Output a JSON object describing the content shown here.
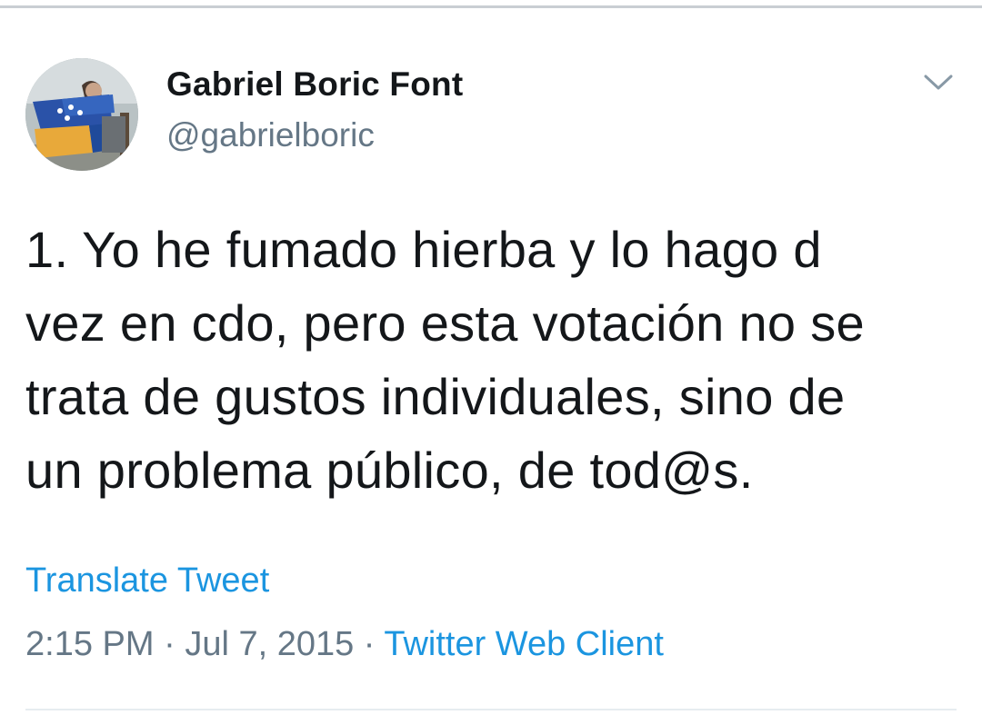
{
  "author": {
    "display_name": "Gabriel Boric Font",
    "handle": "@gabrielboric",
    "avatar_icon": "profile-photo"
  },
  "menu_icon": "chevron-down-icon",
  "tweet": {
    "lines": [
      "1. Yo he fumado hierba y lo hago d",
      "vez en cdo, pero esta votación no se",
      "trata de gustos individuales, sino de",
      "un problema público, de tod@s."
    ]
  },
  "translate_label": "Translate Tweet",
  "meta": {
    "time": "2:15 PM",
    "separator": "·",
    "date": "Jul 7, 2015",
    "source": "Twitter Web Client"
  },
  "colors": {
    "link": "#1b95e0",
    "secondary_text": "#657786",
    "primary_text": "#14171a"
  }
}
